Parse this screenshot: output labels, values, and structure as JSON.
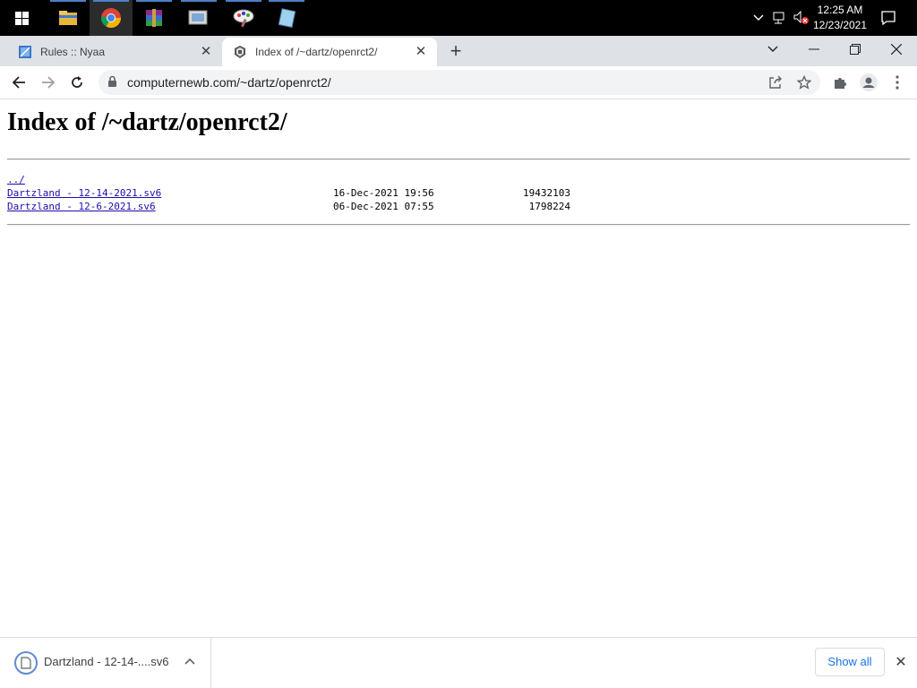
{
  "taskbar": {
    "apps": [
      {
        "name": "file-explorer-icon"
      },
      {
        "name": "chrome-icon"
      },
      {
        "name": "winrar-icon"
      },
      {
        "name": "photos-icon"
      },
      {
        "name": "paint-icon"
      },
      {
        "name": "notepad-icon"
      }
    ],
    "time": "12:25 AM",
    "date": "12/23/2021"
  },
  "tabs": [
    {
      "title": "Rules :: Nyaa",
      "active": false
    },
    {
      "title": "Index of /~dartz/openrct2/",
      "active": true
    }
  ],
  "toolbar": {
    "url": "computernewb.com/~dartz/openrct2/"
  },
  "page": {
    "title": "Index of /~dartz/openrct2/",
    "parent_link": "../",
    "files": [
      {
        "name": "Dartzland - 12-14-2021.sv6",
        "date": "16-Dec-2021 19:56",
        "size": "19432103"
      },
      {
        "name": "Dartzland - 12-6-2021.sv6",
        "date": "06-Dec-2021 07:55",
        "size": "1798224"
      }
    ]
  },
  "downloads": {
    "item_name": "Dartzland - 12-14-....sv6",
    "show_all_label": "Show all"
  },
  "colors": {
    "link": "#1a0dab",
    "accent": "#1a73e8",
    "tabstrip": "#dee1e6"
  }
}
